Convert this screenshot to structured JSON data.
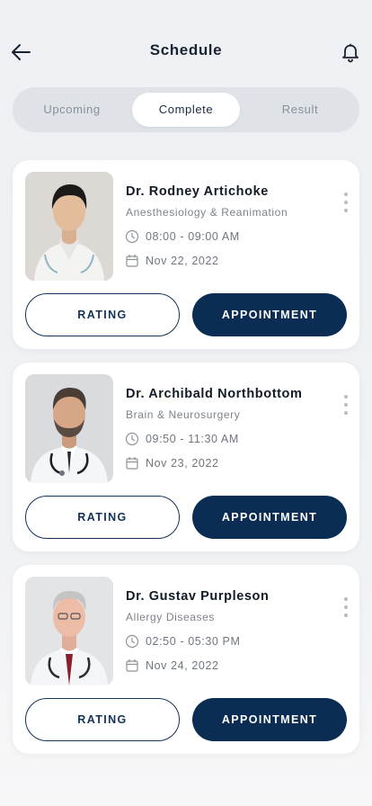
{
  "header": {
    "title": "Schedule",
    "back_icon": "arrow-left-icon",
    "bell_icon": "bell-icon"
  },
  "tabs": [
    {
      "label": "Upcoming",
      "active": false
    },
    {
      "label": "Complete",
      "active": true
    },
    {
      "label": "Result",
      "active": false
    }
  ],
  "colors": {
    "primary": "#0b2d53",
    "background": "#eef0f3",
    "tab_track": "#dfe2e6"
  },
  "cards": [
    {
      "name": "Dr. Rodney Artichoke",
      "specialty": "Anesthesiology & Reanimation",
      "time": "08:00 - 09:00 AM",
      "date": "Nov 22, 2022",
      "rating_label": "RATING",
      "appointment_label": "APPOINTMENT"
    },
    {
      "name": "Dr. Archibald Northbottom",
      "specialty": "Brain & Neurosurgery",
      "time": "09:50 - 11:30 AM",
      "date": "Nov 23, 2022",
      "rating_label": "RATING",
      "appointment_label": "APPOINTMENT"
    },
    {
      "name": "Dr. Gustav Purpleson",
      "specialty": "Allergy Diseases",
      "time": "02:50 - 05:30 PM",
      "date": "Nov 24, 2022",
      "rating_label": "RATING",
      "appointment_label": "APPOINTMENT"
    }
  ]
}
